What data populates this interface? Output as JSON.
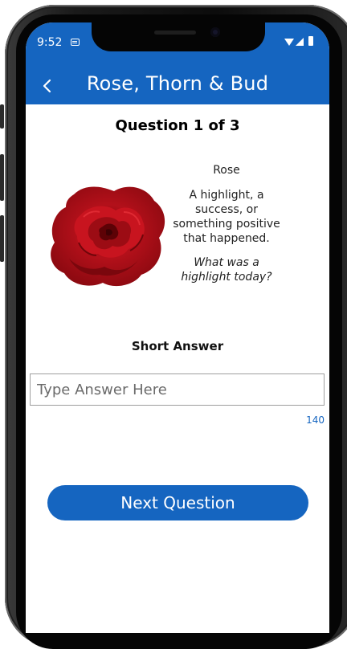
{
  "status_bar": {
    "time": "9:52",
    "icons": [
      "message-icon",
      "wifi-icon",
      "signal-icon",
      "battery-icon"
    ]
  },
  "app_bar": {
    "back_icon": "chevron-left-icon",
    "title": "Rose, Thorn & Bud"
  },
  "question": {
    "counter": "Question 1 of 3",
    "image": "red-rose",
    "prompt_title": "Rose",
    "prompt_description": "A highlight, a success, or something positive that happened.",
    "prompt_question": "What was a highlight today?"
  },
  "answer": {
    "label": "Short Answer",
    "placeholder": "Type Answer Here",
    "value": "",
    "char_limit": "140"
  },
  "actions": {
    "next_label": "Next Question"
  },
  "colors": {
    "primary": "#1565c0",
    "rose": "#b3101a"
  }
}
